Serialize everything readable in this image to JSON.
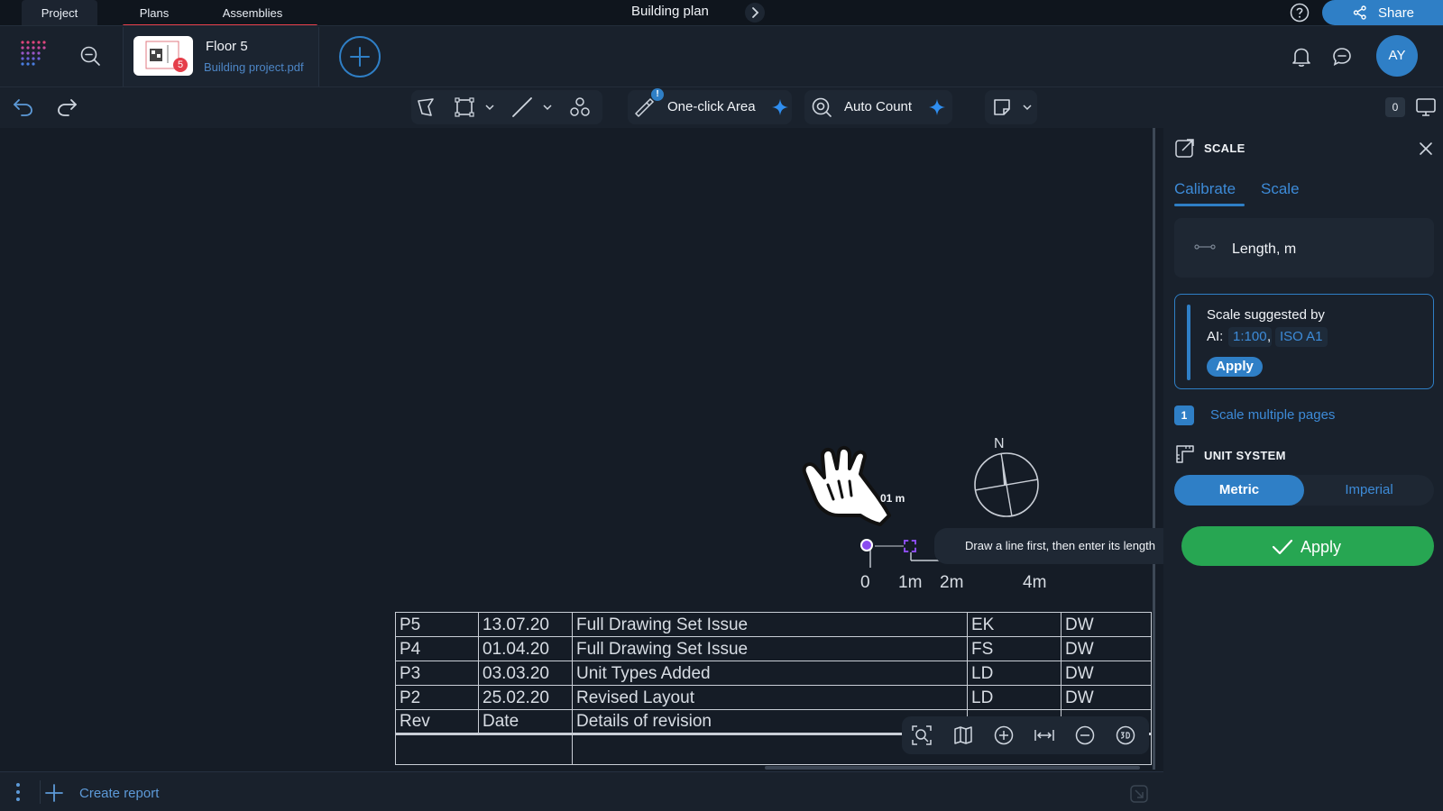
{
  "tabs": {
    "project": "Project",
    "plans": "Plans",
    "assemblies": "Assemblies"
  },
  "title": "Building plan",
  "share_label": "Share",
  "file": {
    "name": "Floor 5",
    "source": "Building project.pdf",
    "badge": "5"
  },
  "avatar": "AY",
  "toolbar": {
    "one_click_area": "One-click Area",
    "auto_count": "Auto Count",
    "counter": "0",
    "alert": "!"
  },
  "canvas": {
    "north": "N",
    "measure": "01 m",
    "scale_ticks": [
      "0",
      "1m",
      "2m",
      "4m"
    ],
    "tooltip": "Draw a line first, then enter its length",
    "revisions": [
      [
        "P5",
        "13.07.20",
        "Full Drawing Set Issue",
        "EK",
        "DW"
      ],
      [
        "P4",
        "01.04.20",
        "Full Drawing Set Issue",
        "FS",
        "DW"
      ],
      [
        "P3",
        "03.03.20",
        "Unit Types Added",
        "LD",
        "DW"
      ],
      [
        "P2",
        "25.02.20",
        "Revised Layout",
        "LD",
        "DW"
      ],
      [
        "Rev",
        "Date",
        "Details of revision",
        "",
        ""
      ]
    ]
  },
  "bottom": {
    "create_report": "Create report"
  },
  "panel": {
    "title": "SCALE",
    "tab_calibrate": "Calibrate",
    "tab_scale": "Scale",
    "length_label": "Length, m",
    "ai_line1": "Scale suggested by",
    "ai_prefix": "AI:",
    "ai_scale": "1:100",
    "ai_sep": ",",
    "ai_paper": "ISO A1",
    "ai_apply": "Apply",
    "pages_count": "1",
    "pages_label": "Scale multiple pages",
    "unit_title": "UNIT SYSTEM",
    "unit_metric": "Metric",
    "unit_imperial": "Imperial",
    "apply": "Apply"
  },
  "colors": {
    "accent": "#2f7fc6",
    "apply_green": "#27a652",
    "tab_red": "#e53e4a",
    "point_purple": "#8a4cf0"
  }
}
